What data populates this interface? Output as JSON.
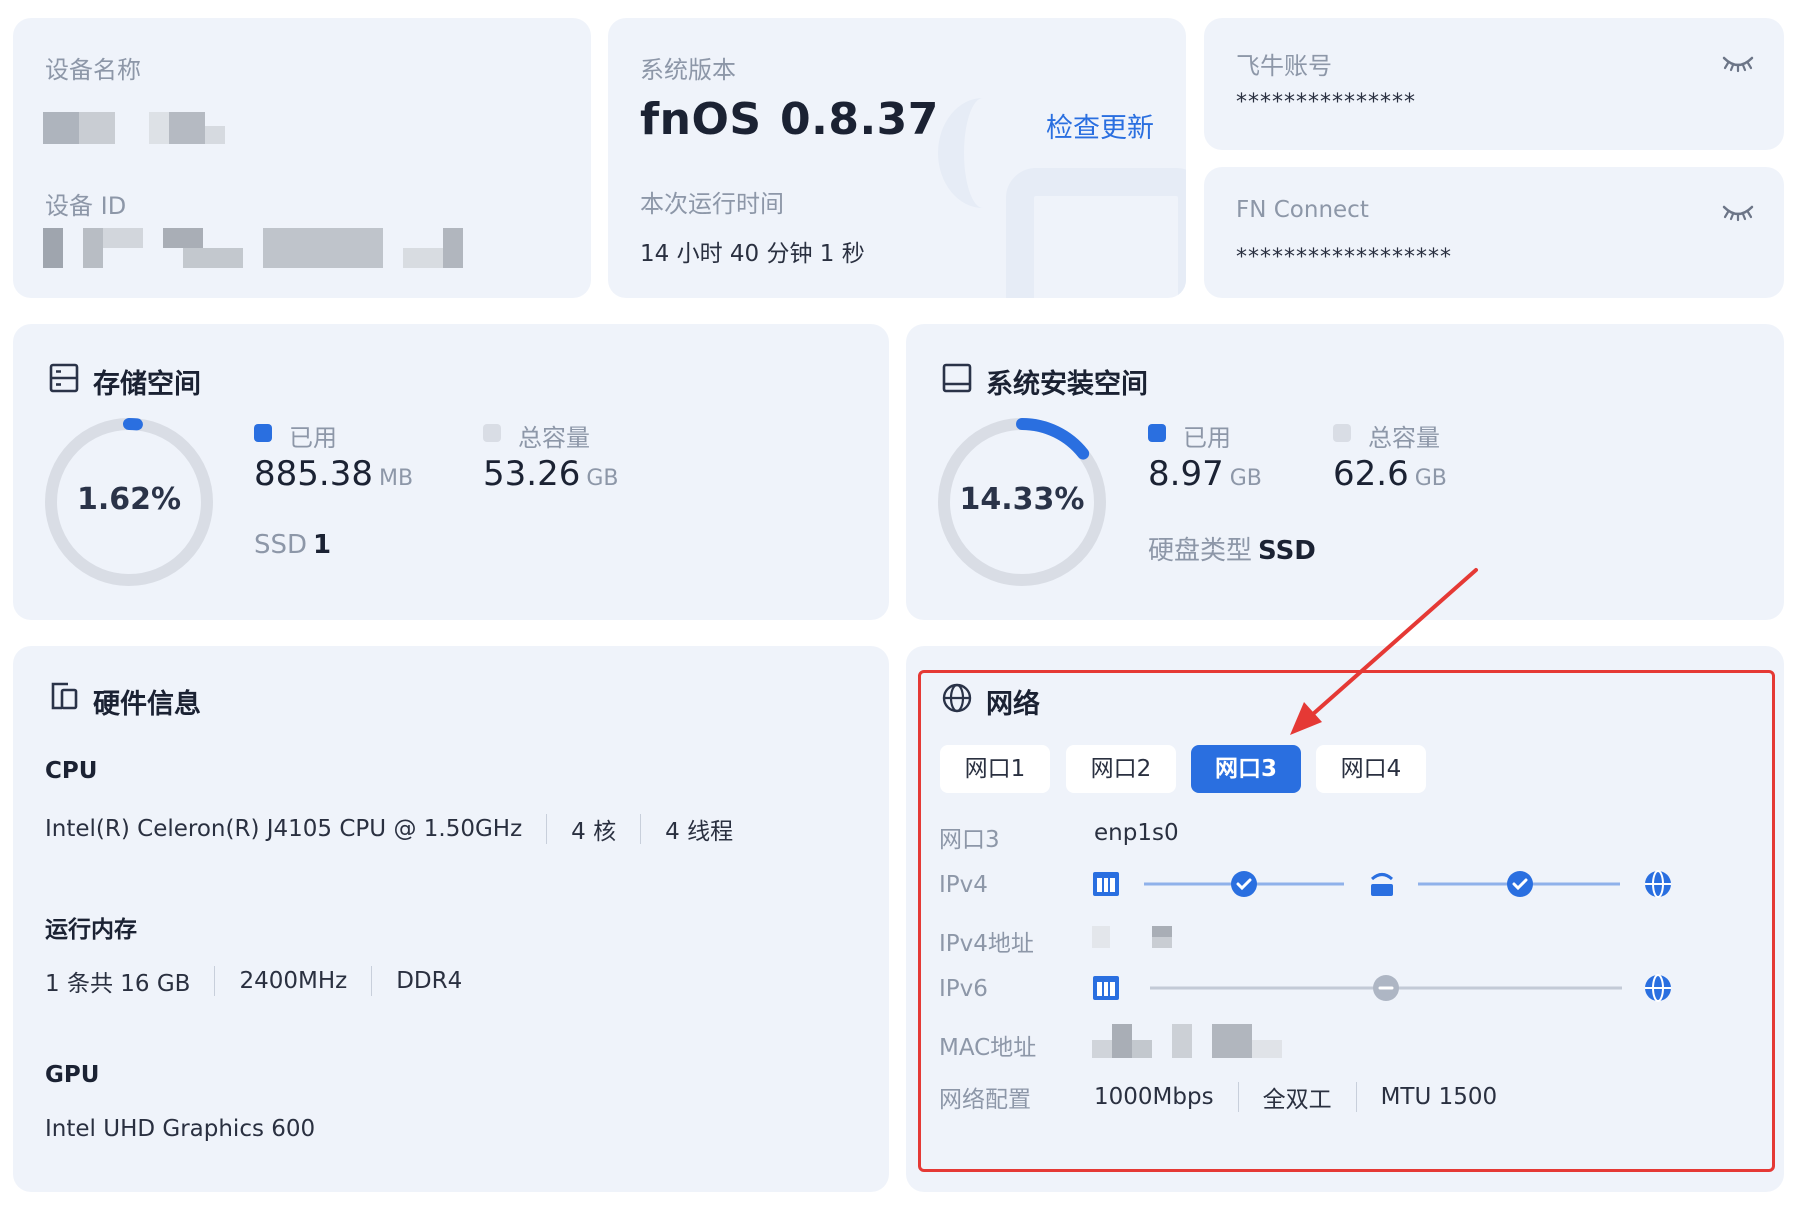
{
  "device": {
    "name_label": "设备名称",
    "id_label": "设备 ID"
  },
  "version": {
    "label": "系统版本",
    "os_name": "fnOS",
    "os_version": "0.8.37",
    "check_update": "检查更新",
    "uptime_label": "本次运行时间",
    "uptime_value": "14 小时 40 分钟 1 秒"
  },
  "account": {
    "label": "飞牛账号",
    "masked": "***************",
    "icon": "eye-closed-icon"
  },
  "connect": {
    "label": "FN Connect",
    "masked": "******************",
    "icon": "eye-closed-icon"
  },
  "storage": {
    "title": "存储空间",
    "icon": "storage-icon",
    "percent_text": "1.62%",
    "percent": 1.62,
    "used_label": "已用",
    "used_value": "885.38",
    "used_unit": "MB",
    "total_label": "总容量",
    "total_value": "53.26",
    "total_unit": "GB",
    "disk_label": "SSD",
    "disk_count": "1"
  },
  "sysspace": {
    "title": "系统安装空间",
    "icon": "drive-icon",
    "percent_text": "14.33%",
    "percent": 14.33,
    "used_label": "已用",
    "used_value": "8.97",
    "used_unit": "GB",
    "total_label": "总容量",
    "total_value": "62.6",
    "total_unit": "GB",
    "disk_type_label": "硬盘类型",
    "disk_type_value": "SSD"
  },
  "hardware": {
    "title": "硬件信息",
    "icon": "devices-icon",
    "cpu_label": "CPU",
    "cpu_model": "Intel(R) Celeron(R) J4105 CPU @ 1.50GHz",
    "cpu_cores": "4 核",
    "cpu_threads": "4 线程",
    "mem_label": "运行内存",
    "mem_size": "1 条共 16 GB",
    "mem_speed": "2400MHz",
    "mem_type": "DDR4",
    "gpu_label": "GPU",
    "gpu_model": "Intel UHD Graphics 600"
  },
  "network": {
    "title": "网络",
    "icon": "globe-icon",
    "tabs": [
      "网口1",
      "网口2",
      "网口3",
      "网口4"
    ],
    "active_tab": 2,
    "port_label": "网口3",
    "port_value": "enp1s0",
    "ipv4_label": "IPv4",
    "ipv4_addr_label": "IPv4地址",
    "ipv6_label": "IPv6",
    "mac_label": "MAC地址",
    "config_label": "网络配置",
    "speed": "1000Mbps",
    "duplex": "全双工",
    "mtu": "MTU 1500"
  },
  "colors": {
    "accent": "#2a6fe0",
    "card": "#eff3fa",
    "muted": "#8d97a8",
    "highlight": "#e53935"
  }
}
